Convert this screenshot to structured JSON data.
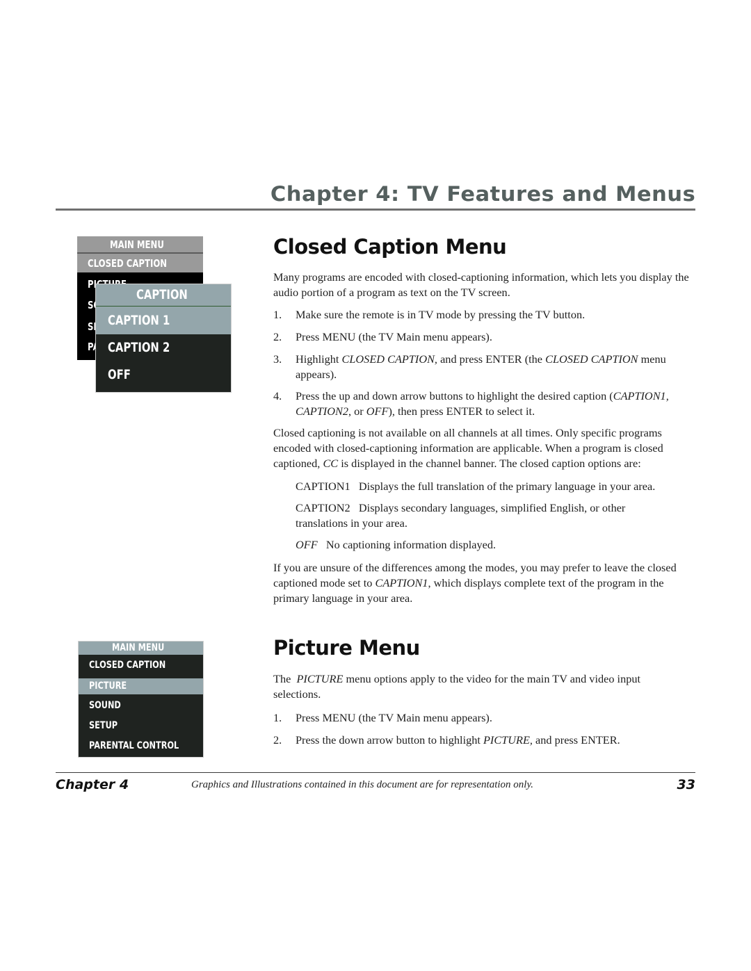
{
  "header": {
    "chapter_title": "Chapter 4: TV Features and Menus"
  },
  "closed_caption": {
    "title": "Closed Caption Menu",
    "intro": "Many programs are encoded with closed-captioning information, which lets you display the audio portion of a program as text on the TV screen.",
    "steps": [
      {
        "num": "1.",
        "text": "Make sure the remote is in TV mode by pressing the TV button."
      },
      {
        "num": "2.",
        "text": "Press MENU (the TV Main menu appears)."
      },
      {
        "num": "3.",
        "pre": "Highlight ",
        "em1": "CLOSED CAPTION,",
        "mid": " and press ENTER (the ",
        "em2": "CLOSED CAPTION",
        "post": " menu appears)."
      },
      {
        "num": "4.",
        "pre": "Press the up and down arrow buttons to highlight the desired caption (",
        "em1": "CAPTION1, CAPTION2",
        "mid": ", or ",
        "em2": "OFF",
        "post": "), then press ENTER to select it."
      }
    ],
    "availability_pre": "Closed captioning is not available on all channels at all times. Only specific programs encoded with closed-captioning information are applicable. When a program is closed captioned, ",
    "availability_em": "CC",
    "availability_post": " is displayed in the channel banner. The closed caption options are:",
    "options": [
      {
        "name": "CAPTION1",
        "desc": "Displays the full translation of the primary language in your area."
      },
      {
        "name": "CAPTION2",
        "desc": "Displays secondary languages, simplified English, or other translations in your area."
      },
      {
        "name": "OFF",
        "desc": "No captioning information displayed."
      }
    ],
    "advice_pre": "If you are unsure of the differences among the modes, you may prefer to leave the closed captioned mode set to ",
    "advice_em": "CAPTION1",
    "advice_post": ", which displays complete text of the program in the primary language in your area."
  },
  "picture": {
    "title": "Picture Menu",
    "intro_pre": "The  ",
    "intro_em": "PICTURE",
    "intro_post": " menu options apply to the video for the main TV and video input selections.",
    "steps": [
      {
        "num": "1.",
        "text": "Press MENU (the TV Main menu appears)."
      },
      {
        "num": "2.",
        "pre": "Press the down arrow button to highlight ",
        "em1": "PICTURE,",
        "post": " and press ENTER."
      }
    ]
  },
  "tv_menu_1": {
    "header": "MAIN MENU",
    "highlighted": "CLOSED CAPTION",
    "items": [
      "PICTURE",
      "SOUND",
      "SETUP",
      "PARENTAL CONTROL"
    ],
    "colors": {
      "header_bg": "#9a9a9a",
      "body_bg": "#000000"
    }
  },
  "caption_submenu": {
    "header": "CAPTION",
    "highlighted": "CAPTION 1",
    "items": [
      "CAPTION 2",
      "OFF"
    ],
    "colors": {
      "header_bg": "#94a6ab",
      "body_bg": "#1f2320"
    }
  },
  "tv_menu_2": {
    "header": "MAIN MENU",
    "items": [
      "CLOSED CAPTION",
      "PICTURE",
      "SOUND",
      "SETUP",
      "PARENTAL CONTROL"
    ],
    "highlighted": "PICTURE",
    "colors": {
      "highlight_bg": "#94a6ab",
      "body_bg": "#1f2320"
    }
  },
  "footer": {
    "chapter": "Chapter 4",
    "note": "Graphics and Illustrations contained in this document are for representation only.",
    "page": "33"
  }
}
